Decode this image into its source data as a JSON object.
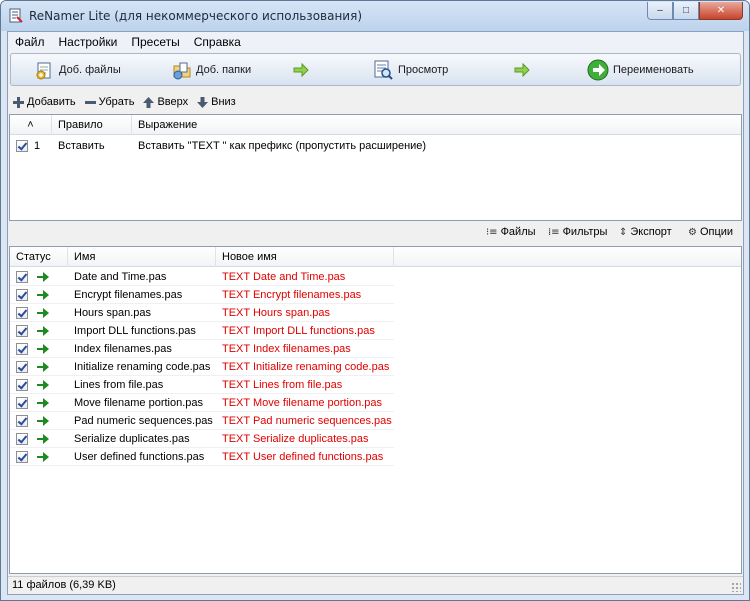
{
  "window": {
    "title": "ReNamer Lite (для некоммерческого использования)",
    "buttons": {
      "minimize": "–",
      "maximize": "□",
      "close": "✕"
    }
  },
  "menu": [
    "Файл",
    "Настройки",
    "Пресеты",
    "Справка"
  ],
  "toolbar": {
    "add_files": "Доб. файлы",
    "add_folders": "Доб. папки",
    "preview": "Просмотр",
    "rename": "Переименовать"
  },
  "rules_toolbar": {
    "add": "Добавить",
    "remove": "Убрать",
    "up": "Вверх",
    "down": "Вниз"
  },
  "rules_table": {
    "columns": {
      "sort": "˄",
      "rule": "Правило",
      "expression": "Выражение"
    },
    "rows": [
      {
        "checked": true,
        "index": "1",
        "rule": "Вставить",
        "expression": "Вставить \"TEXT \" как префикс (пропустить расширение)"
      }
    ]
  },
  "files_toolbar": {
    "files": "Файлы",
    "filters": "Фильтры",
    "export": "Экспорт",
    "options": "Опции"
  },
  "files_table": {
    "columns": {
      "status": "Статус",
      "name": "Имя",
      "new_name": "Новое имя"
    },
    "rows": [
      {
        "checked": true,
        "name": "Date and Time.pas",
        "new_name": "TEXT Date and Time.pas"
      },
      {
        "checked": true,
        "name": "Encrypt filenames.pas",
        "new_name": "TEXT Encrypt filenames.pas"
      },
      {
        "checked": true,
        "name": "Hours span.pas",
        "new_name": "TEXT Hours span.pas"
      },
      {
        "checked": true,
        "name": "Import DLL functions.pas",
        "new_name": "TEXT Import DLL functions.pas"
      },
      {
        "checked": true,
        "name": "Index filenames.pas",
        "new_name": "TEXT Index filenames.pas"
      },
      {
        "checked": true,
        "name": "Initialize renaming code.pas",
        "new_name": "TEXT Initialize renaming code.pas"
      },
      {
        "checked": true,
        "name": "Lines from file.pas",
        "new_name": "TEXT Lines from file.pas"
      },
      {
        "checked": true,
        "name": "Move filename portion.pas",
        "new_name": "TEXT Move filename portion.pas"
      },
      {
        "checked": true,
        "name": "Pad numeric sequences.pas",
        "new_name": "TEXT Pad numeric sequences.pas"
      },
      {
        "checked": true,
        "name": "Serialize duplicates.pas",
        "new_name": "TEXT Serialize duplicates.pas"
      },
      {
        "checked": true,
        "name": "User defined functions.pas",
        "new_name": "TEXT User defined functions.pas"
      }
    ]
  },
  "status": {
    "text": "11 файлов (6,39 KB)"
  },
  "colors": {
    "new_name_text": "#e00000",
    "status_arrow": "#1f8a1f"
  },
  "icons": {
    "add_files": "add-files-icon",
    "add_folders": "add-folders-icon",
    "preview": "preview-icon",
    "rename": "rename-icon",
    "flow_arrow": "green-arrow-icon",
    "status_ok": "green-arrow-icon"
  }
}
